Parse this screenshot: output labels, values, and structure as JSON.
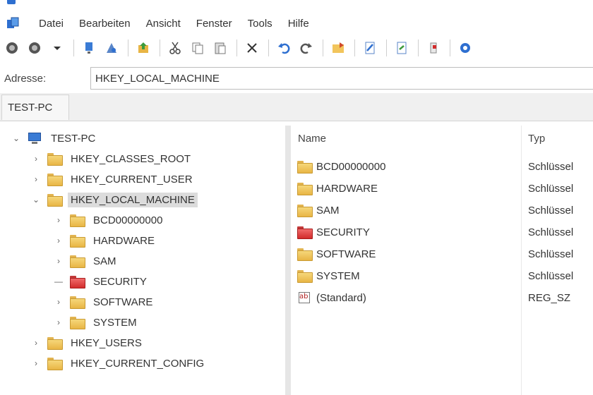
{
  "menu": {
    "items": [
      "Datei",
      "Bearbeiten",
      "Ansicht",
      "Fenster",
      "Tools",
      "Hilfe"
    ]
  },
  "toolbar": {
    "icons": [
      "back-icon",
      "forward-icon",
      "dropdown-arrow-icon",
      "computer-icon",
      "connect-icon",
      "export-icon",
      "cut-icon",
      "copy-icon",
      "paste-icon",
      "delete-icon",
      "undo-icon",
      "redo-icon",
      "open-folder-icon",
      "edit-icon",
      "document-icon",
      "refresh-icon",
      "settings-icon"
    ]
  },
  "address": {
    "label": "Adresse:",
    "value": "HKEY_LOCAL_MACHINE"
  },
  "tabs": [
    {
      "label": "TEST-PC"
    }
  ],
  "tree": {
    "root": "TEST-PC",
    "hives": [
      {
        "label": "HKEY_CLASSES_ROOT",
        "expanded": false
      },
      {
        "label": "HKEY_CURRENT_USER",
        "expanded": false
      },
      {
        "label": "HKEY_LOCAL_MACHINE",
        "expanded": true,
        "selected": true
      },
      {
        "label": "HKEY_USERS",
        "expanded": false
      },
      {
        "label": "HKEY_CURRENT_CONFIG",
        "expanded": false
      }
    ],
    "hklm_children": [
      {
        "label": "BCD00000000",
        "icon": "folder-icon"
      },
      {
        "label": "HARDWARE",
        "icon": "folder-icon"
      },
      {
        "label": "SAM",
        "icon": "folder-icon"
      },
      {
        "label": "SECURITY",
        "icon": "locked-folder-icon"
      },
      {
        "label": "SOFTWARE",
        "icon": "folder-icon"
      },
      {
        "label": "SYSTEM",
        "icon": "folder-icon"
      }
    ]
  },
  "list": {
    "columns": [
      "Name",
      "Typ"
    ],
    "rows": [
      {
        "name": "BCD00000000",
        "type": "Schlüssel",
        "icon": "folder-icon"
      },
      {
        "name": "HARDWARE",
        "type": "Schlüssel",
        "icon": "folder-icon"
      },
      {
        "name": "SAM",
        "type": "Schlüssel",
        "icon": "folder-icon"
      },
      {
        "name": "SECURITY",
        "type": "Schlüssel",
        "icon": "locked-folder-icon"
      },
      {
        "name": "SOFTWARE",
        "type": "Schlüssel",
        "icon": "folder-icon"
      },
      {
        "name": "SYSTEM",
        "type": "Schlüssel",
        "icon": "folder-icon"
      },
      {
        "name": "(Standard)",
        "type": "REG_SZ",
        "icon": "string-value-icon"
      }
    ]
  },
  "colors": {
    "folder": "#e8b545",
    "security_folder": "#d22c2c",
    "accent": "#2e6fd0",
    "selection": "#dcdcdc"
  }
}
